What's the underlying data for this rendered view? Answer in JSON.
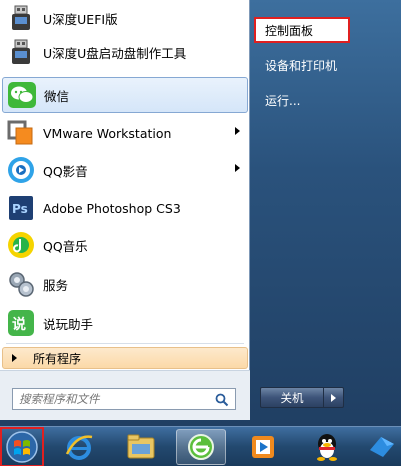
{
  "left_pane": {
    "programs": [
      {
        "label": "U深度UEFI版",
        "icon": "usb-drive-icon",
        "has_submenu": false
      },
      {
        "label": "U深度U盘启动盘制作工具",
        "icon": "usb-drive-icon",
        "has_submenu": false
      },
      {
        "label": "微信",
        "icon": "wechat-icon",
        "has_submenu": false
      },
      {
        "label": "VMware Workstation",
        "icon": "vmware-icon",
        "has_submenu": true
      },
      {
        "label": "QQ影音",
        "icon": "qq-player-icon",
        "has_submenu": true
      },
      {
        "label": "Adobe Photoshop CS3",
        "icon": "photoshop-icon",
        "has_submenu": false
      },
      {
        "label": "QQ音乐",
        "icon": "qq-music-icon",
        "has_submenu": false
      },
      {
        "label": "服务",
        "icon": "services-gear-icon",
        "has_submenu": false
      },
      {
        "label": "说玩助手",
        "icon": "shuowan-icon",
        "has_submenu": false
      }
    ],
    "all_programs": "所有程序",
    "search": {
      "placeholder": "搜索程序和文件"
    }
  },
  "right_pane": {
    "items": [
      "控制面板",
      "设备和打印机",
      "运行..."
    ],
    "shutdown_label": "关机"
  },
  "taskbar": {
    "apps": [
      "start-orb",
      "internet-explorer-icon",
      "file-explorer-icon",
      "360-browser-icon",
      "media-player-icon",
      "qq-penguin-icon",
      "feishu-icon"
    ]
  },
  "colors": {
    "highlight_border": "#e02020",
    "selected_item": "#d5e6f9",
    "all_programs_bg": "#fbd9a8"
  }
}
